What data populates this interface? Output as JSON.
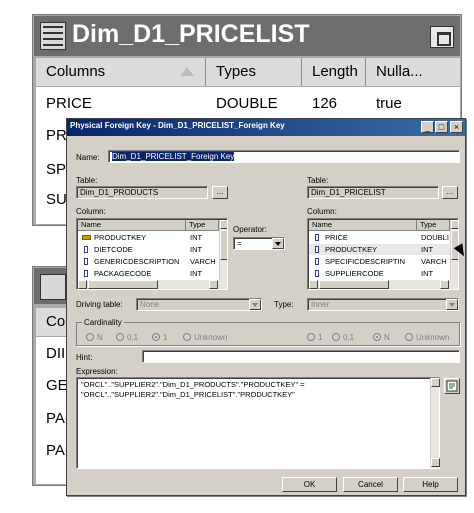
{
  "background_table": {
    "title": "Dim_D1_PRICELIST",
    "columns": [
      "Columns",
      "Types",
      "Length",
      "Nulla..."
    ],
    "rows": [
      [
        "PRICE",
        "DOUBLE",
        "126",
        "true"
      ],
      [
        "PR",
        "",
        "",
        ""
      ],
      [
        "SPI",
        "",
        "",
        ""
      ],
      [
        "SU",
        "",
        "",
        ""
      ]
    ]
  },
  "background_table2": {
    "colhdr": "Col",
    "rows": [
      "DII",
      "GE",
      "PA(",
      "PA("
    ]
  },
  "dialog": {
    "title": "Physical Foreign Key - Dim_D1_PRICELIST_Foreign Key",
    "name_label": "Name:",
    "name_value": "Dim_D1_PRICELIST_Foreign Key",
    "left": {
      "table_label": "Table:",
      "table_value": "Dim_D1_PRODUCTS",
      "browse": "...",
      "column_label": "Column:",
      "headers": [
        "Name",
        "Type"
      ],
      "rows": [
        {
          "name": "PRODUCTKEY",
          "type": "INT"
        },
        {
          "name": "DIETCODE",
          "type": "INT"
        },
        {
          "name": "GENERICDESCRIPTION",
          "type": "VARCH"
        },
        {
          "name": "PACKAGECODE",
          "type": "INT"
        }
      ]
    },
    "operator_label": "Operator:",
    "operator_value": "=",
    "right": {
      "table_label": "Table:",
      "table_value": "Dim_D1_PRICELIST",
      "browse": "...",
      "column_label": "Column:",
      "headers": [
        "Name",
        "Type"
      ],
      "rows": [
        {
          "name": "PRICE",
          "type": "DOUBLI"
        },
        {
          "name": "PRODUCTKEY",
          "type": "INT"
        },
        {
          "name": "SPECIFICDESCRIPTIN",
          "type": "VARCH"
        },
        {
          "name": "SUPPLIERCODE",
          "type": "INT"
        }
      ]
    },
    "driving_label": "Driving table:",
    "driving_value": "None",
    "type_label": "Type:",
    "type_value": "Inner",
    "cardinality_label": "Cardinality",
    "cardinality_left": [
      "N",
      "0,1",
      "1",
      "Unknown"
    ],
    "cardinality_right": [
      "1",
      "0,1",
      "N",
      "Unknown"
    ],
    "hint_label": "Hint:",
    "hint_value": "",
    "expression_label": "Expression:",
    "expression_lines": [
      "\"ORCL\"..\"SUPPLIER2\".\"Dim_D1_PRODUCTS\".\"PRODUCTKEY\" =",
      "\"ORCL\"..\"SUPPLIER2\".\"Dim_D1_PRICELIST\".\"PRODUCTKEY\""
    ],
    "ok_label": "OK",
    "cancel_label": "Cancel",
    "help_label": "Help",
    "titlebar_buttons": [
      "_",
      "□",
      "×"
    ]
  }
}
